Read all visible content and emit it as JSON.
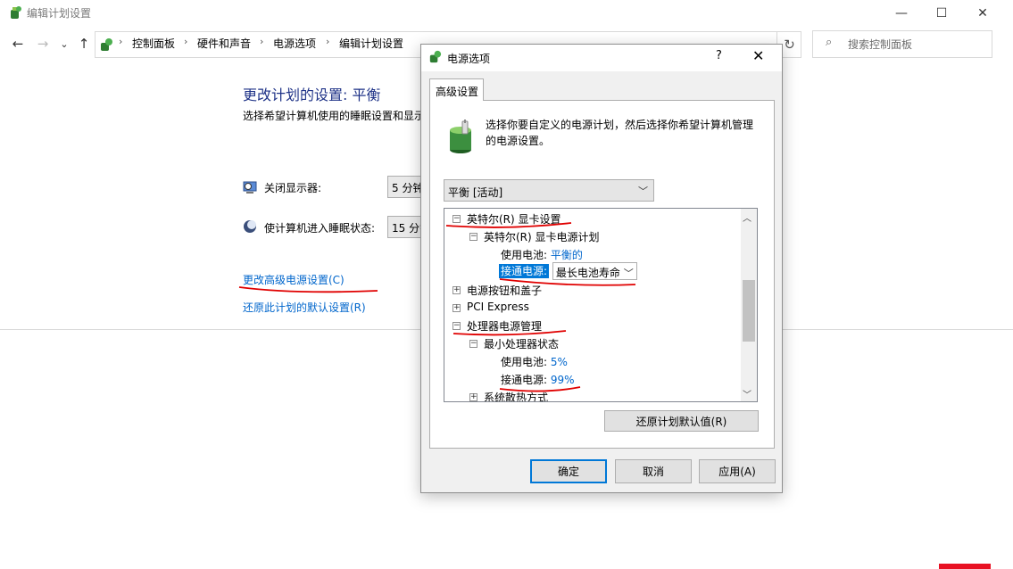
{
  "window": {
    "title": "编辑计划设置",
    "minimize": "—",
    "maximize": "☐",
    "close": "✕"
  },
  "nav": {
    "back": "←",
    "forward": "→",
    "recent": "⌄",
    "up": "↑",
    "sep": "›",
    "refresh": "↻",
    "breadcrumbs": [
      "控制面板",
      "硬件和声音",
      "电源选项",
      "编辑计划设置"
    ]
  },
  "search": {
    "placeholder": "搜索控制面板",
    "icon": "⌕"
  },
  "main": {
    "heading": "更改计划的设置: 平衡",
    "subtext": "选择希望计算机使用的睡眠设置和显示",
    "display_off": {
      "label": "关闭显示器:",
      "value": "5 分钟"
    },
    "sleep": {
      "label": "使计算机进入睡眠状态:",
      "value": "15 分钟"
    },
    "advanced_link": "更改高级电源设置(C)",
    "restore_link": "还原此计划的默认设置(R)"
  },
  "dialog": {
    "title": "电源选项",
    "help": "?",
    "close": "✕",
    "tab": "高级设置",
    "description": "选择你要自定义的电源计划，然后选择你希望计算机管理的电源设置。",
    "plan": "平衡 [活动]",
    "tree": {
      "graphics": "英特尔(R) 显卡设置",
      "graphics_plan": "英特尔(R) 显卡电源计划",
      "battery_label": "使用电池:",
      "battery_value": "平衡的",
      "plugged_label": "接通电源:",
      "plugged_value": "最长电池寿命",
      "buttons_lid": "电源按钮和盖子",
      "pci": "PCI Express",
      "cpu": "处理器电源管理",
      "min_cpu": "最小处理器状态",
      "cpu_battery_label": "使用电池:",
      "cpu_battery_value": "5%",
      "cpu_plugged_label": "接通电源:",
      "cpu_plugged_value": "99%",
      "cooling": "系统散热方式"
    },
    "restore_btn": "还原计划默认值(R)",
    "ok": "确定",
    "cancel": "取消",
    "apply": "应用(A)"
  },
  "colors": {
    "accent": "#0078d7",
    "link": "#0066cc",
    "heading": "#1e3287",
    "annotation": "#e00000"
  }
}
